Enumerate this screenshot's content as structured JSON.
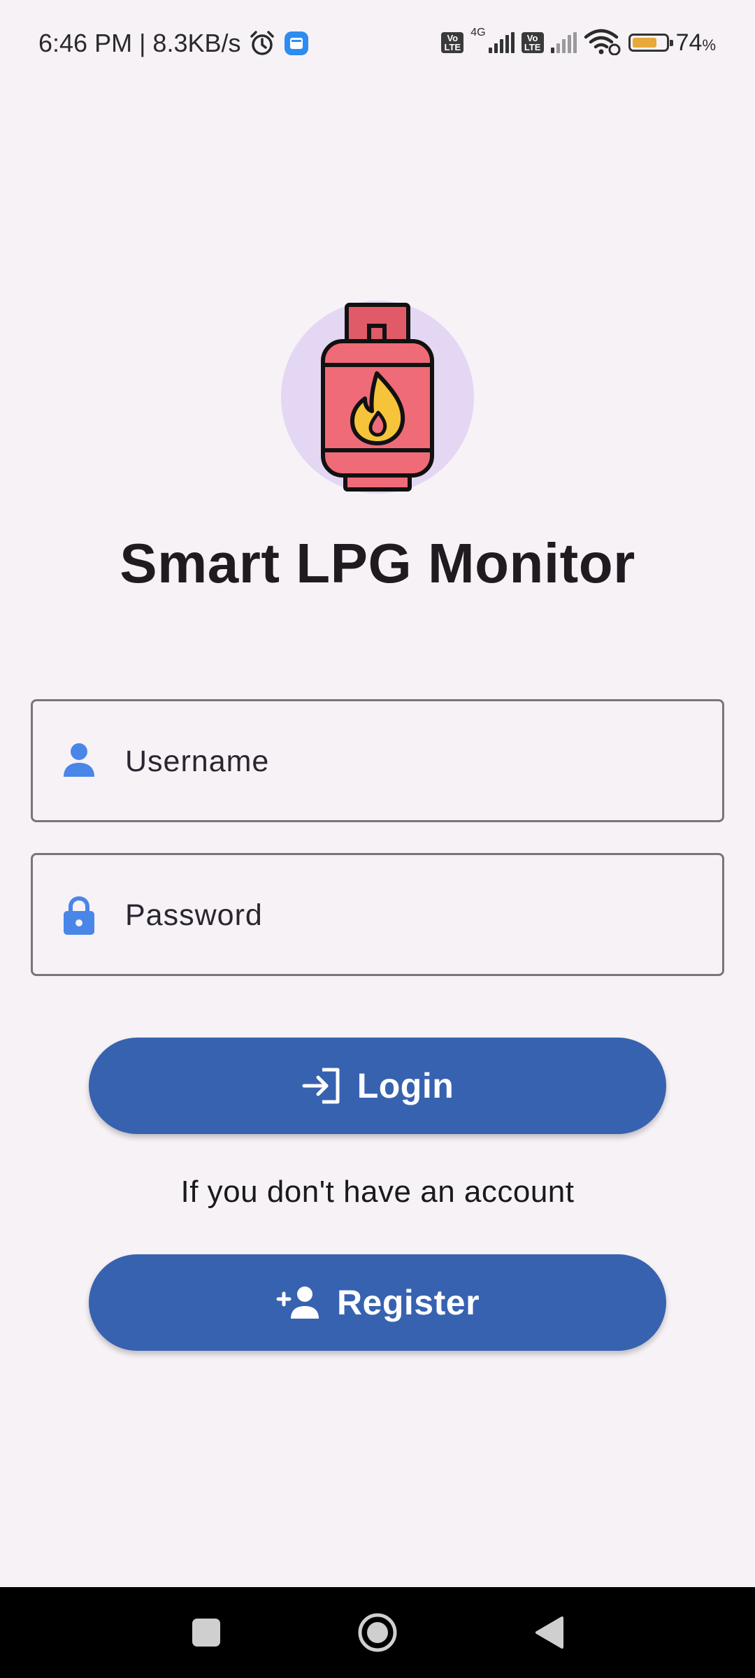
{
  "status_bar": {
    "time_speed": "6:46 PM | 8.3KB/s",
    "net_type": "4G",
    "volte_label": "Vo\nLTE",
    "battery_percent": "74",
    "battery_percent_sign": "%",
    "battery_level": 0.74,
    "battery_color": "#e8a93a"
  },
  "app": {
    "title": "Smart LPG Monitor",
    "logo_icon": "gas-cylinder-flame-icon"
  },
  "form": {
    "username_placeholder": "Username",
    "password_placeholder": "Password",
    "username_icon": "person-icon",
    "password_icon": "lock-icon"
  },
  "actions": {
    "login_label": "Login",
    "register_hint": "If you don't have an account",
    "register_label": "Register"
  },
  "colors": {
    "background": "#f7f2f6",
    "primary": "#3762b0",
    "icon_blue": "#4a86e8",
    "logo_circle": "#e4d7f3",
    "cylinder_red": "#ef6b77"
  }
}
